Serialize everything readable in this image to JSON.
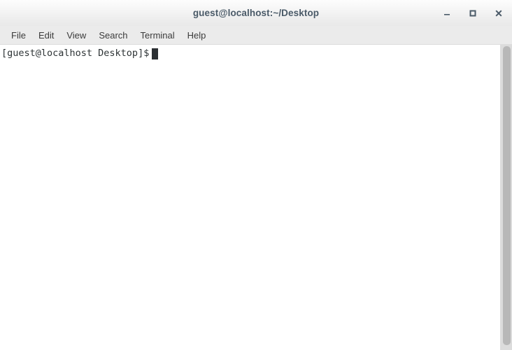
{
  "window": {
    "title": "guest@localhost:~/Desktop",
    "controls": {
      "minimize_name": "minimize",
      "maximize_name": "maximize",
      "close_name": "close"
    }
  },
  "menubar": {
    "items": [
      {
        "label": "File"
      },
      {
        "label": "Edit"
      },
      {
        "label": "View"
      },
      {
        "label": "Search"
      },
      {
        "label": "Terminal"
      },
      {
        "label": "Help"
      }
    ]
  },
  "terminal": {
    "lines": [
      {
        "text": "[guest@localhost Desktop]$"
      }
    ],
    "prompt_user": "guest",
    "prompt_host": "localhost",
    "prompt_dir": "Desktop",
    "cursor_visible": true,
    "background": "#ffffff",
    "foreground": "#2e3436"
  },
  "scrollbar": {
    "orientation": "vertical",
    "track_color": "#dcdcdc",
    "thumb_color": "#b8b8b8"
  }
}
